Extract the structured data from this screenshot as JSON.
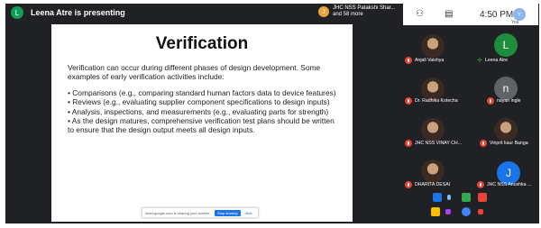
{
  "presenter": {
    "initial": "L",
    "text": "Leena Atre is presenting"
  },
  "host_chip": {
    "initial": "J",
    "line1": "JHC NSS Patakshi Shar...",
    "line2": "and 58 more"
  },
  "status_bar": {
    "time": "4:50 PM",
    "you_label": "You",
    "you_initial": "Y"
  },
  "slide": {
    "title": "Verification",
    "intro": "Verification can occur during different phases of design development. Some examples of early verification activities include:",
    "bullets": [
      "• Comparisons (e.g., comparing standard human factors data to device features)",
      "• Reviews (e.g., evaluating supplier component specifications to design inputs)",
      "• Analysis, inspections, and measurements (e.g., evaluating parts for strength)",
      "• As the design matures, comprehensive verification test plans should be written to ensure that the design output meets all design inputs."
    ]
  },
  "share_bar": {
    "message": "meet.google.com is sharing your screen.",
    "stop": "Stop sharing",
    "hide": "Hide"
  },
  "participants": [
    {
      "name": "Anjali Vaishya",
      "avatar": "photo"
    },
    {
      "name": "Leena Atre",
      "avatar": "L",
      "color": "#1e8e3e"
    },
    {
      "name": "Dr. Radhika Kotecha",
      "avatar": "photo"
    },
    {
      "name": "nayan ingle",
      "avatar": "n",
      "color": "#5f6368"
    },
    {
      "name": "JHC NSS VINAY CH...",
      "avatar": "photo"
    },
    {
      "name": "Vinprit kaur Banga",
      "avatar": "photo"
    },
    {
      "name": "DHARITA DESAI",
      "avatar": "photo"
    },
    {
      "name": "JHC NSS Anushka ...",
      "avatar": "J",
      "color": "#1a73e8"
    }
  ]
}
